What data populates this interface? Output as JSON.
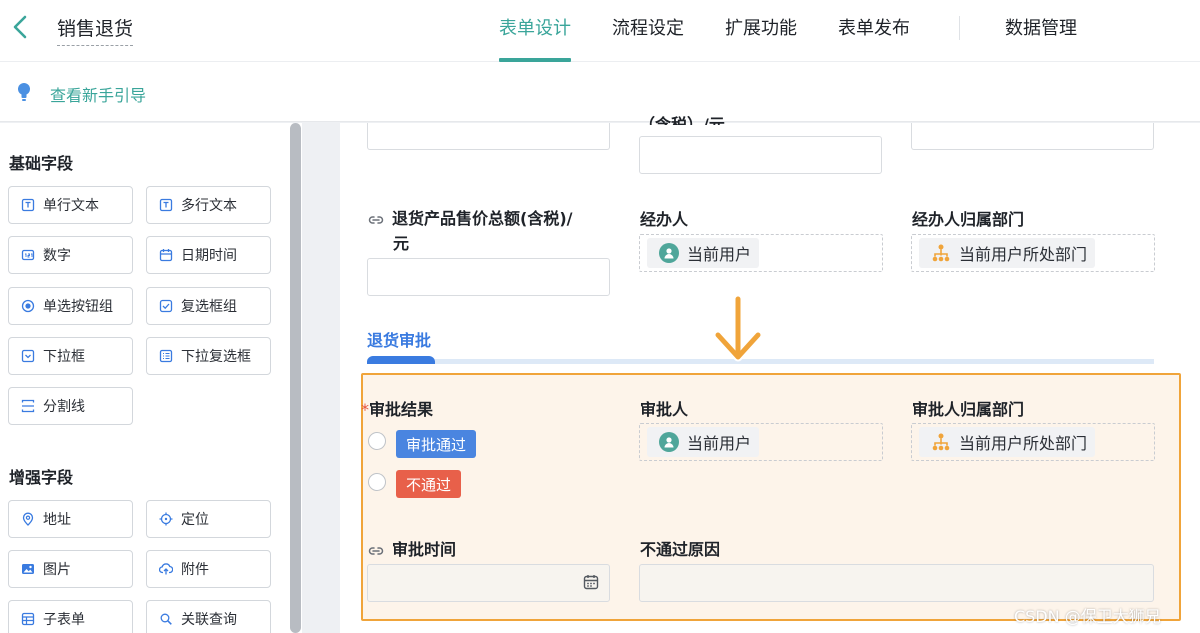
{
  "header": {
    "title": "销售退货",
    "tabs": [
      {
        "label": "表单设计",
        "active": true
      },
      {
        "label": "流程设定",
        "active": false
      },
      {
        "label": "扩展功能",
        "active": false
      },
      {
        "label": "表单发布",
        "active": false
      }
    ],
    "data_manage_label": "数据管理"
  },
  "guide": {
    "text": "查看新手引导"
  },
  "palette": {
    "basic_title": "基础字段",
    "basic_fields": [
      {
        "label": "单行文本",
        "icon": "text-line-icon"
      },
      {
        "label": "多行文本",
        "icon": "text-multi-icon"
      },
      {
        "label": "数字",
        "icon": "number-icon"
      },
      {
        "label": "日期时间",
        "icon": "calendar-icon"
      },
      {
        "label": "单选按钮组",
        "icon": "radio-icon"
      },
      {
        "label": "复选框组",
        "icon": "checkbox-icon"
      },
      {
        "label": "下拉框",
        "icon": "dropdown-icon"
      },
      {
        "label": "下拉复选框",
        "icon": "dropdown-multi-icon"
      },
      {
        "label": "分割线",
        "icon": "divider-icon"
      }
    ],
    "enhanced_title": "增强字段",
    "enhanced_fields": [
      {
        "label": "地址",
        "icon": "location-pin-icon"
      },
      {
        "label": "定位",
        "icon": "crosshair-icon"
      },
      {
        "label": "图片",
        "icon": "image-icon"
      },
      {
        "label": "附件",
        "icon": "upload-cloud-icon"
      },
      {
        "label": "子表单",
        "icon": "subform-icon"
      },
      {
        "label": "关联查询",
        "icon": "link-query-icon"
      }
    ]
  },
  "form": {
    "top_partial_label": "（含税）/元",
    "refund_total_label_line1": "退货产品售价总额(含税)/",
    "refund_total_label_line2": "元",
    "handler_label": "经办人",
    "handler_value": "当前用户",
    "handler_dept_label": "经办人归属部门",
    "handler_dept_value": "当前用户所处部门",
    "section_name": "退货审批",
    "approval_result_label": "审批结果",
    "required_mark": "*",
    "approval_options": [
      "审批通过",
      "不通过"
    ],
    "approver_label": "审批人",
    "approver_value": "当前用户",
    "approver_dept_label": "审批人归属部门",
    "approver_dept_value": "当前用户所处部门",
    "approval_time_label": "审批时间",
    "reject_reason_label": "不通过原因"
  },
  "watermark": "CSDN @保卫大狮兄",
  "colors": {
    "accent": "#3aa59a",
    "section_blue": "#3a7be0",
    "highlight_border": "#f0a43a",
    "tag_pass": "#4a85e0",
    "tag_reject": "#e8604a"
  }
}
